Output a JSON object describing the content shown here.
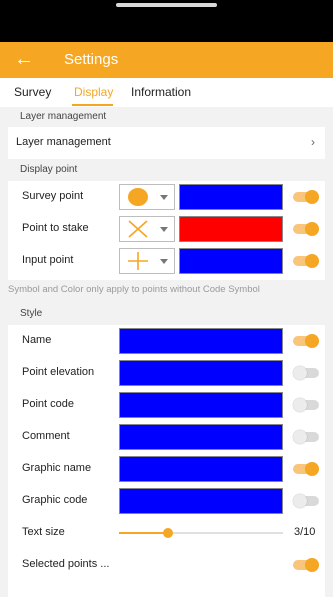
{
  "app_bar": {
    "back_icon": "arrow-left",
    "title": "Settings",
    "color": "#f5a623"
  },
  "tabs": [
    {
      "label": "Survey",
      "active": false
    },
    {
      "label": "Display",
      "active": true
    },
    {
      "label": "Information",
      "active": false
    }
  ],
  "layer_section": {
    "header": "Layer management",
    "row_label": "Layer management",
    "chevron": "›"
  },
  "display_point": {
    "header": "Display point",
    "rows": [
      {
        "label": "Survey point",
        "symbol": "filled-circle",
        "color": "#0000ff",
        "toggle": true
      },
      {
        "label": "Point to stake",
        "symbol": "cross-x",
        "color": "#ff0000",
        "toggle": true
      },
      {
        "label": "Input point",
        "symbol": "plus",
        "color": "#0000ff",
        "toggle": true
      }
    ],
    "note": "Symbol and Color only apply to points without Code Symbol"
  },
  "style": {
    "header": "Style",
    "rows": [
      {
        "label": "Name",
        "color": "#0000ff",
        "toggle": true
      },
      {
        "label": "Point elevation",
        "color": "#0000ff",
        "toggle": false
      },
      {
        "label": "Point code",
        "color": "#0000ff",
        "toggle": false
      },
      {
        "label": "Comment",
        "color": "#0000ff",
        "toggle": false
      },
      {
        "label": "Graphic name",
        "color": "#0000ff",
        "toggle": true
      },
      {
        "label": "Graphic code",
        "color": "#0000ff",
        "toggle": false
      }
    ],
    "text_size": {
      "label": "Text size",
      "value": 3,
      "max": 10,
      "display": "3/10"
    },
    "selected_points": {
      "label": "Selected points ...",
      "toggle": true
    }
  }
}
